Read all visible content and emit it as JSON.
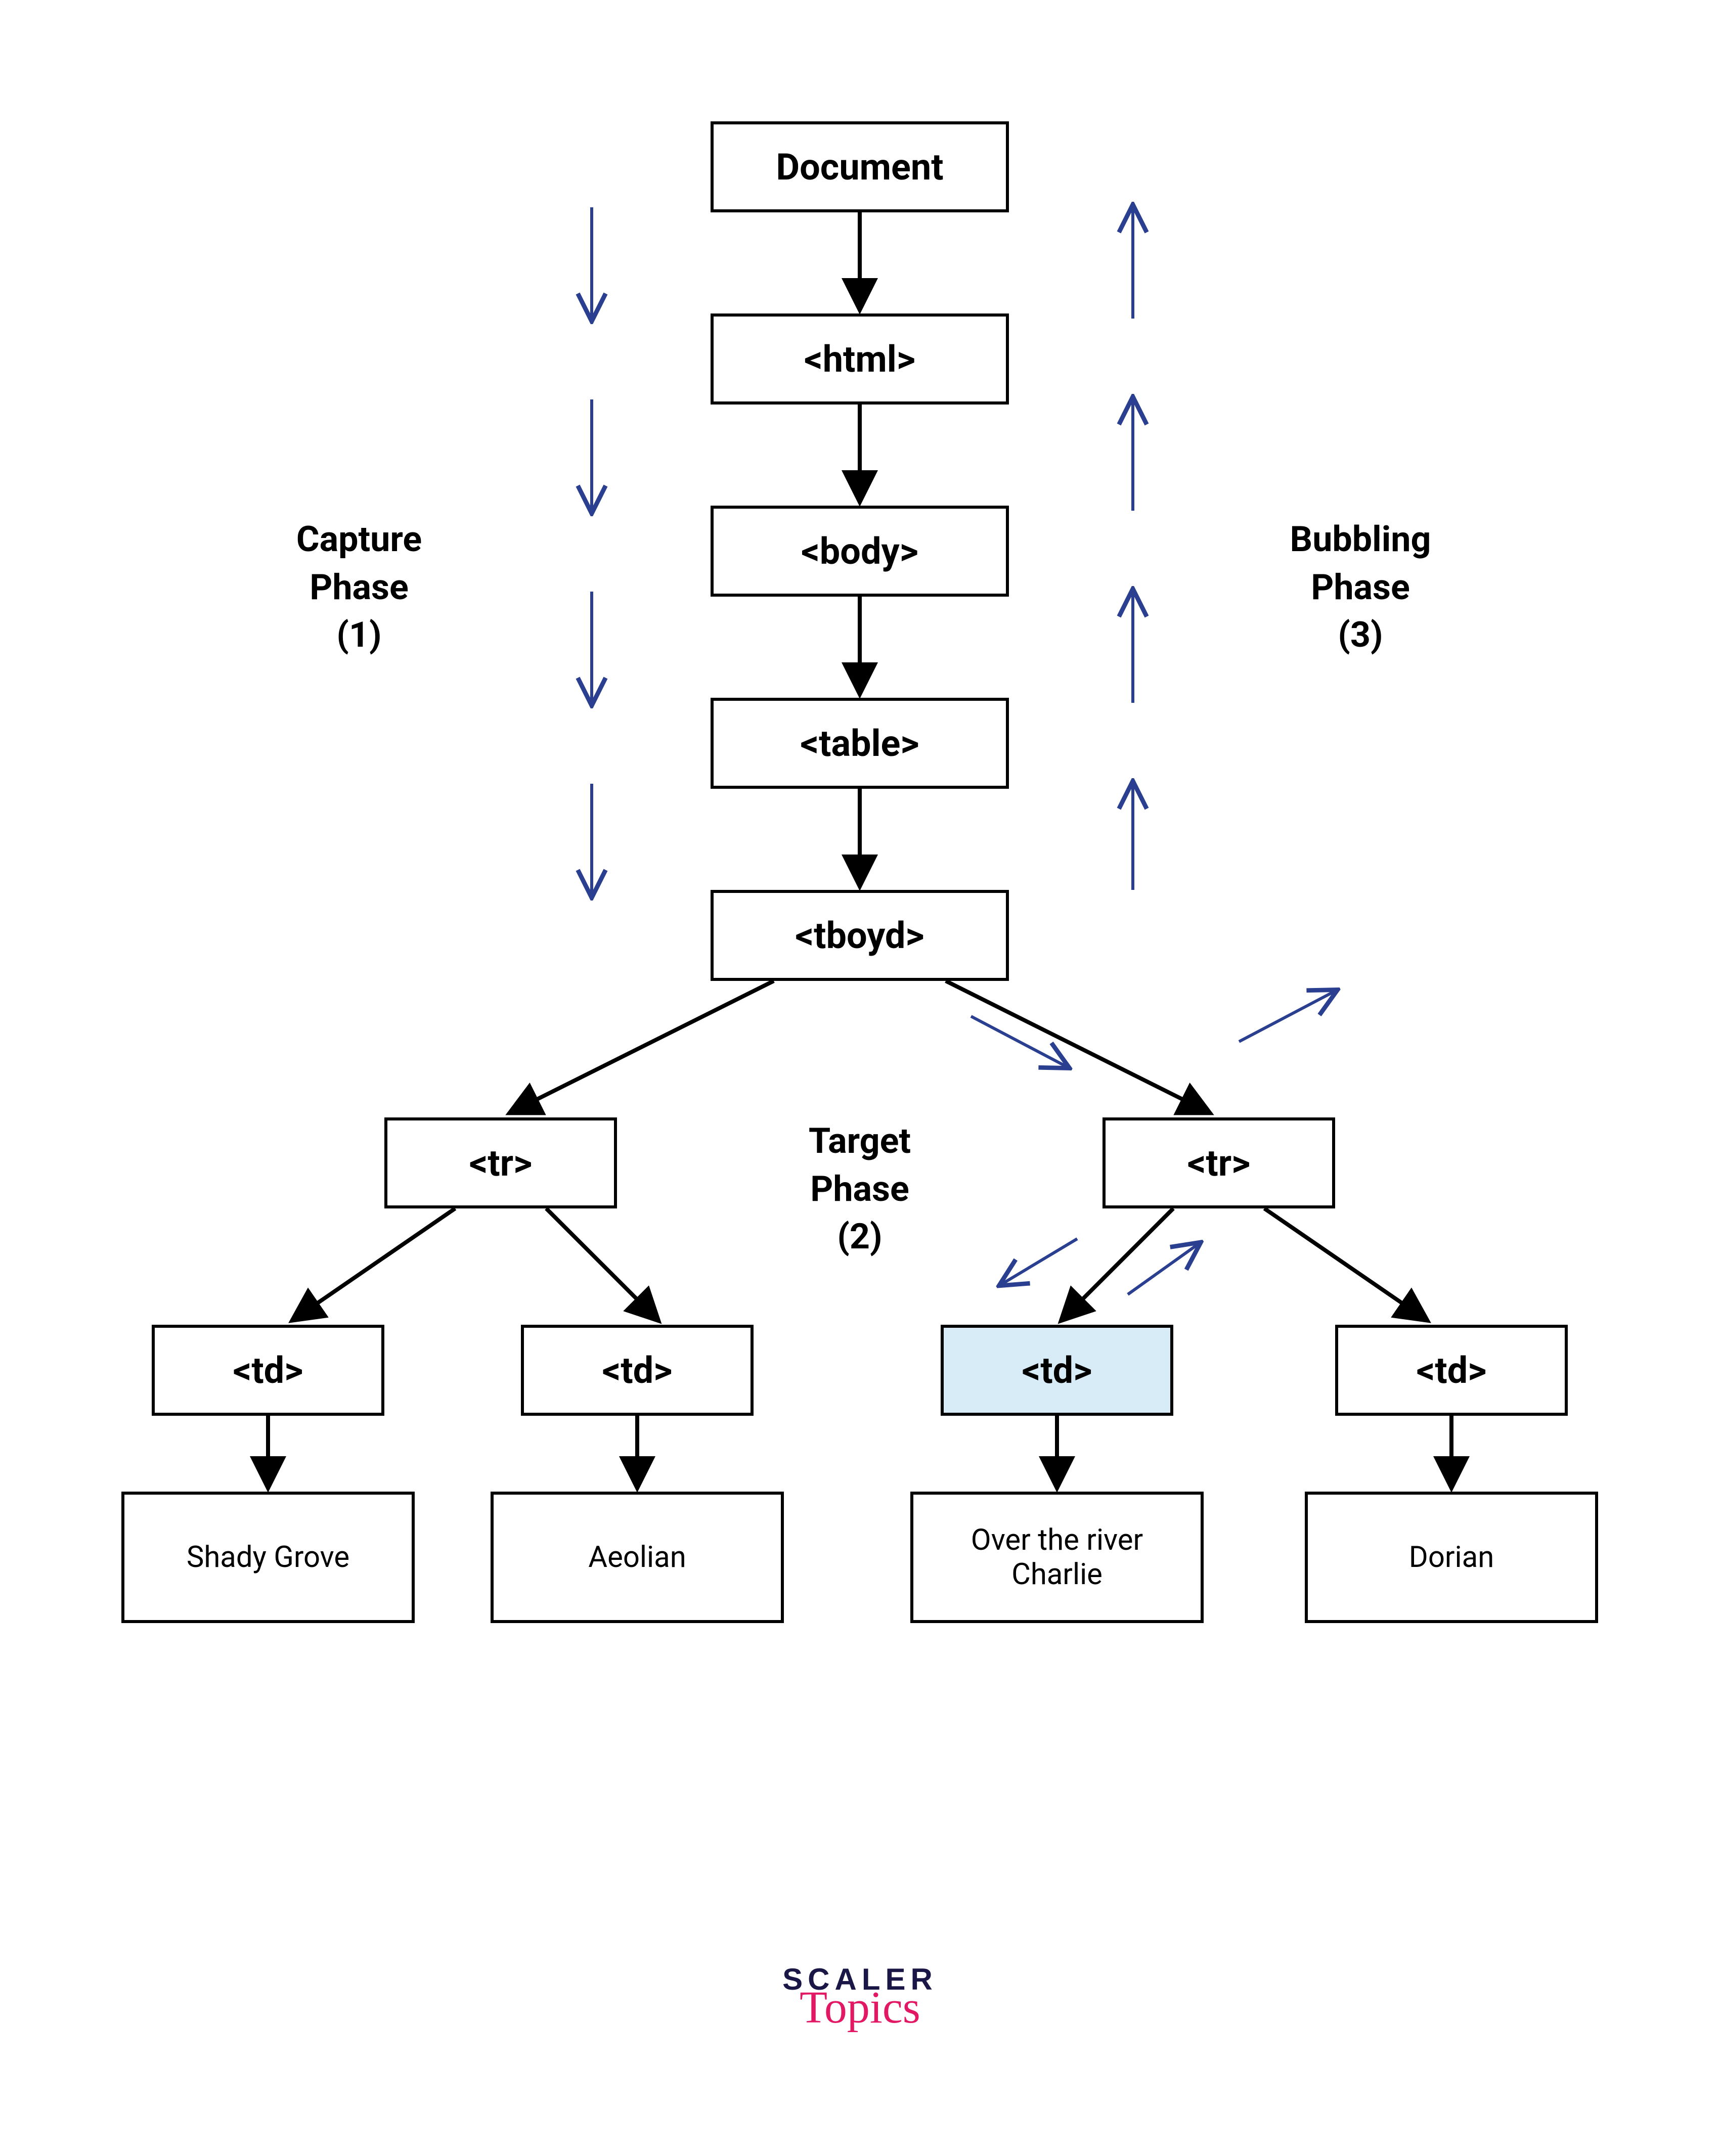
{
  "phases": {
    "capture": "Capture\nPhase\n(1)",
    "target": "Target\nPhase\n(2)",
    "bubbling": "Bubbling\nPhase\n(3)"
  },
  "nodes": {
    "document": "Document",
    "html": "<html>",
    "body": "<body>",
    "table": "<table>",
    "tbody": "<tboyd>",
    "tr1": "<tr>",
    "tr2": "<tr>",
    "td1": "<td>",
    "td2": "<td>",
    "td3": "<td>",
    "td4": "<td>"
  },
  "leaves": {
    "leaf1": "Shady Grove",
    "leaf2": "Aeolian",
    "leaf3": "Over the river Charlie",
    "leaf4": "Dorian"
  },
  "branding": {
    "line1": "SCALER",
    "line2": "Topics"
  },
  "colors": {
    "highlight": "#d8ecf7",
    "connector_black": "#000000",
    "connector_blue": "#2a3f8f",
    "brand_navy": "#1a1646",
    "brand_pink": "#e31864"
  }
}
